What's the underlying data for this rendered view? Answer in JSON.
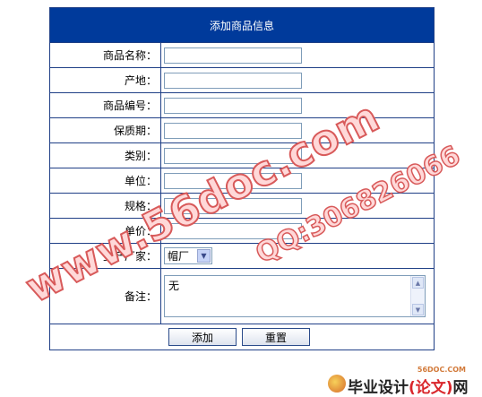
{
  "form": {
    "title": "添加商品信息",
    "rows": [
      {
        "label": "商品名称：",
        "value": ""
      },
      {
        "label": "产地：",
        "value": ""
      },
      {
        "label": "商品编号：",
        "value": ""
      },
      {
        "label": "保质期：",
        "value": ""
      },
      {
        "label": "类别：",
        "value": ""
      },
      {
        "label": "单位：",
        "value": ""
      },
      {
        "label": "规格：",
        "value": ""
      },
      {
        "label": "单价：",
        "value": ""
      }
    ],
    "manufacturer": {
      "label": "生产厂家：",
      "selected": "帽厂"
    },
    "remark": {
      "label": "备注：",
      "value": "无"
    },
    "buttons": {
      "add": "添加",
      "reset": "重置"
    }
  },
  "watermark": {
    "line1": "www.56doc.com",
    "line2": "QQ:306826066"
  },
  "logo": {
    "small": "56DOC.COM",
    "main_prefix": "毕业设计",
    "main_paren": "(论文)",
    "main_suffix": "网"
  },
  "colors": {
    "header_bg": "#003a9b",
    "border": "#1f3f86"
  }
}
